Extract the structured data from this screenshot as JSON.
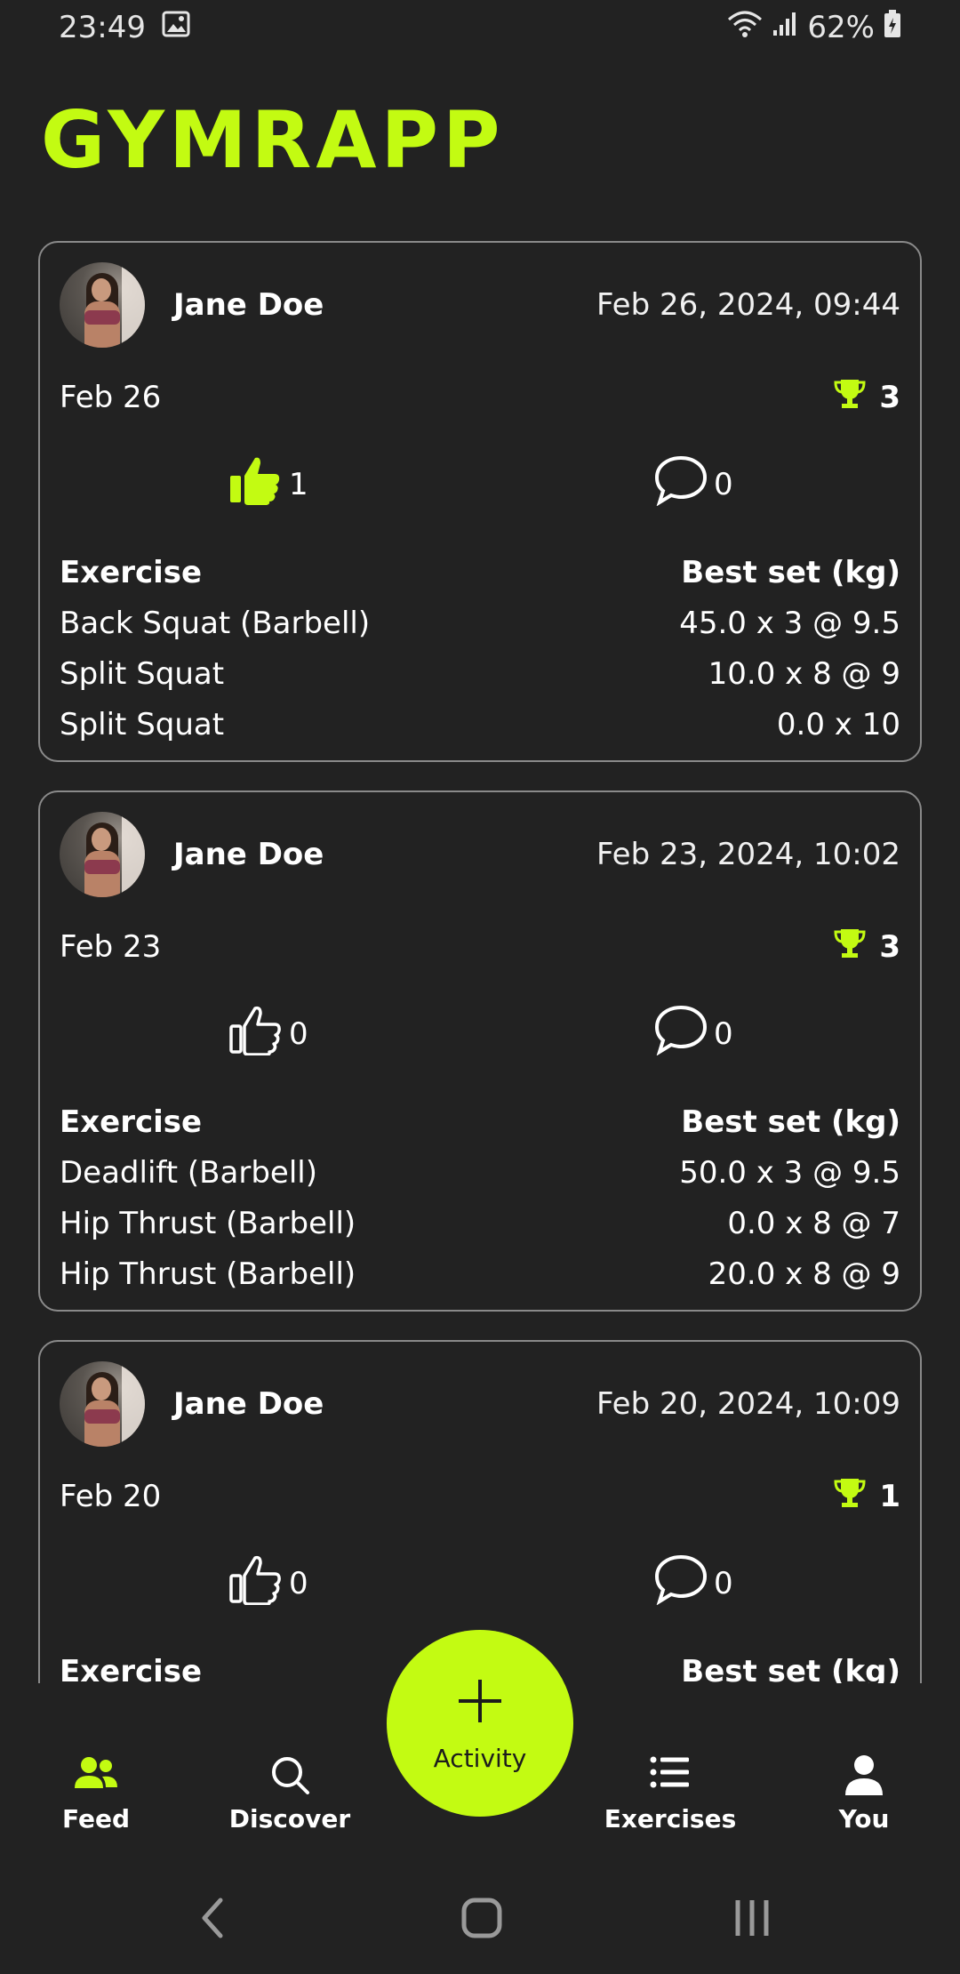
{
  "colors": {
    "accent": "#c3fb12",
    "background": "#222222",
    "card_border": "#8a8a8a"
  },
  "status_bar": {
    "time": "23:49",
    "battery": "62%",
    "icons": [
      "image-icon",
      "wifi-icon",
      "signal-icon",
      "battery-icon"
    ]
  },
  "app": {
    "title": "GYMRAPP"
  },
  "posts": [
    {
      "user": "Jane Doe",
      "timestamp": "Feb 26, 2024, 09:44",
      "date": "Feb 26",
      "trophies": "3",
      "likes": "1",
      "liked": true,
      "comments": "0",
      "table_header": {
        "exercise": "Exercise",
        "best_set": "Best set (kg)"
      },
      "rows": [
        {
          "exercise": "Back Squat (Barbell)",
          "best_set": "45.0 x 3 @ 9.5"
        },
        {
          "exercise": "Split Squat",
          "best_set": "10.0 x 8 @ 9"
        },
        {
          "exercise": "Split Squat",
          "best_set": "0.0 x 10"
        }
      ]
    },
    {
      "user": "Jane Doe",
      "timestamp": "Feb 23, 2024, 10:02",
      "date": "Feb 23",
      "trophies": "3",
      "likes": "0",
      "liked": false,
      "comments": "0",
      "table_header": {
        "exercise": "Exercise",
        "best_set": "Best set (kg)"
      },
      "rows": [
        {
          "exercise": "Deadlift (Barbell)",
          "best_set": "50.0 x 3 @ 9.5"
        },
        {
          "exercise": "Hip Thrust (Barbell)",
          "best_set": "0.0 x 8 @ 7"
        },
        {
          "exercise": "Hip Thrust (Barbell)",
          "best_set": "20.0 x 8 @ 9"
        }
      ]
    },
    {
      "user": "Jane Doe",
      "timestamp": "Feb 20, 2024, 10:09",
      "date": "Feb 20",
      "trophies": "1",
      "likes": "0",
      "liked": false,
      "comments": "0",
      "table_header": {
        "exercise": "Exercise",
        "best_set": "Best set (kg)"
      },
      "rows": []
    }
  ],
  "bottom_nav": {
    "feed": "Feed",
    "discover": "Discover",
    "activity": "Activity",
    "exercises": "Exercises",
    "you": "You"
  }
}
